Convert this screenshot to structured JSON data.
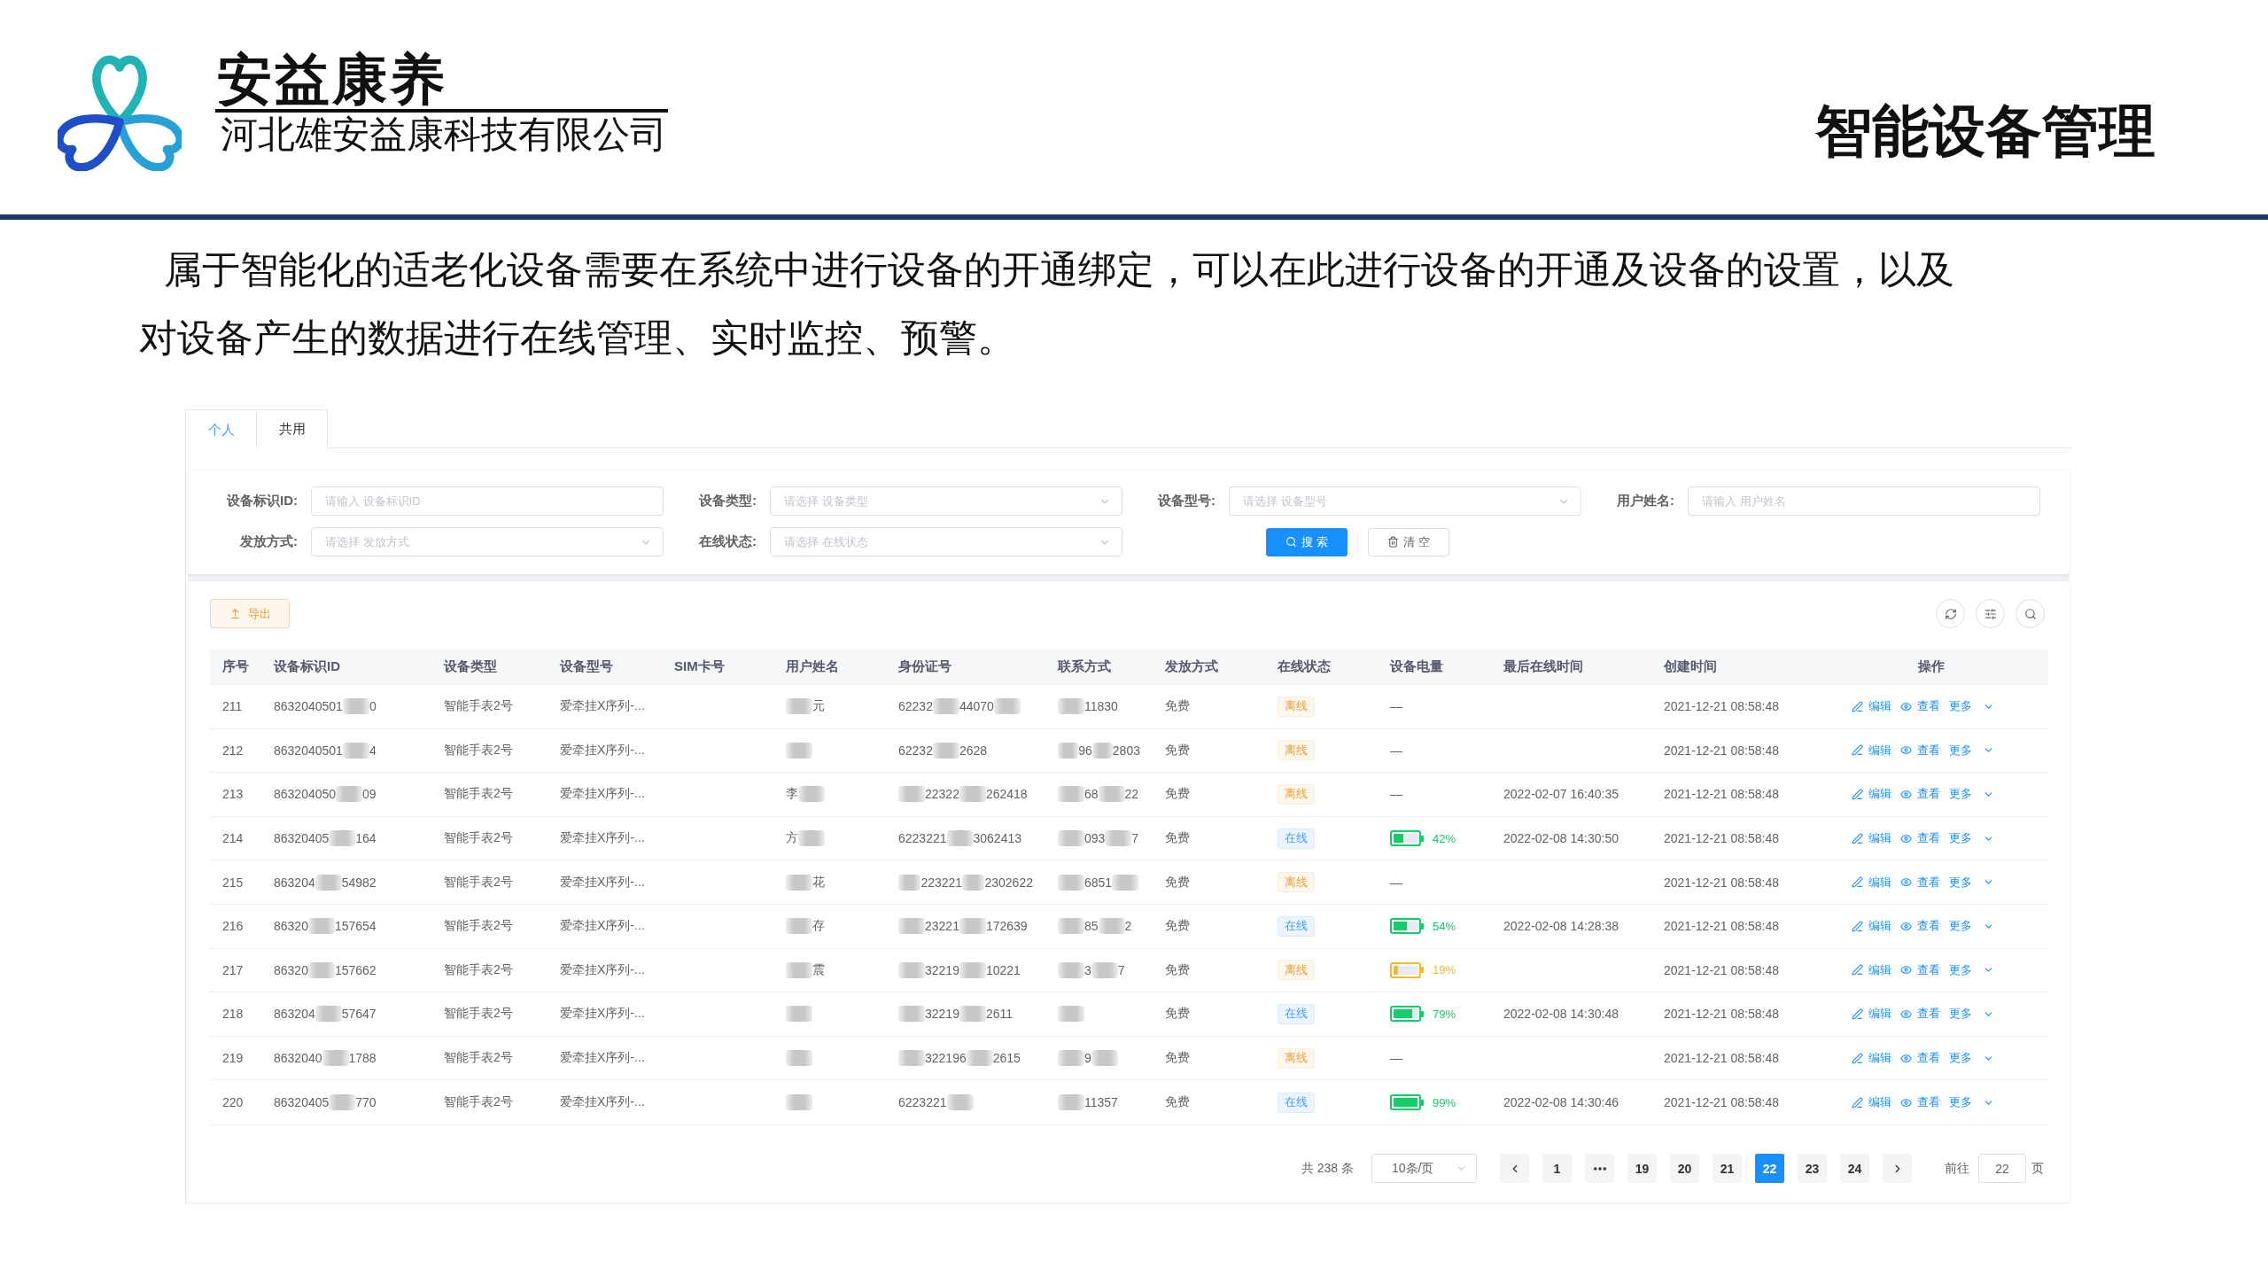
{
  "header": {
    "brand": "安益康养",
    "company": "河北雄安益康科技有限公司",
    "title": "智能设备管理"
  },
  "intro": "属于智能化的适老化设备需要在系统中进行设备的开通绑定，可以在此进行设备的开通及设备的设置，以及对设备产生的数据进行在线管理、实时监控、预警。",
  "screenshot": {
    "tabs": [
      {
        "label": "个人",
        "selected": true
      },
      {
        "label": "共用",
        "selected": false
      }
    ],
    "filters": [
      {
        "kind": "input",
        "label": "设备标识ID:",
        "placeholder": "请输入 设备标识ID"
      },
      {
        "kind": "select",
        "label": "设备类型:",
        "placeholder": "请选择 设备类型"
      },
      {
        "kind": "select",
        "label": "设备型号:",
        "placeholder": "请选择 设备型号"
      },
      {
        "kind": "input",
        "label": "用户姓名:",
        "placeholder": "请输入 用户姓名"
      },
      {
        "kind": "select",
        "label": "发放方式:",
        "placeholder": "请选择 发放方式"
      },
      {
        "kind": "select",
        "label": "在线状态:",
        "placeholder": "请选择 在线状态"
      }
    ],
    "buttons": [
      {
        "kind": "search",
        "label": "搜 索"
      },
      {
        "kind": "clear",
        "label": "清 空"
      }
    ],
    "export_button": "导出",
    "table": {
      "columns": [
        "序号",
        "设备标识ID",
        "设备类型",
        "设备型号",
        "SIM卡号",
        "用户姓名",
        "身份证号",
        "联系方式",
        "发放方式",
        "在线状态",
        "设备电量",
        "最后在线时间",
        "创建时间",
        "操作"
      ],
      "rows": [
        {
          "index": "211",
          "device_id": [
            {
              "kind": "text",
              "text": "8632040501"
            },
            {
              "kind": "blur"
            },
            {
              "kind": "text",
              "text": "0"
            }
          ],
          "device_type": "智能手表2号",
          "model": "爱牵挂X序列-...",
          "name": [
            {
              "kind": "blur"
            },
            {
              "kind": "text",
              "text": "元"
            }
          ],
          "id_card": [
            {
              "kind": "text",
              "text": "62232"
            },
            {
              "kind": "blur"
            },
            {
              "kind": "text",
              "text": "44070"
            },
            {
              "kind": "blur"
            }
          ],
          "phone": [
            {
              "kind": "blur"
            },
            {
              "kind": "text",
              "text": "11830"
            }
          ],
          "method": "免费",
          "status": {
            "text": "离线",
            "online": false
          },
          "battery": {
            "kind": "dash",
            "text": "—"
          },
          "created": "2021-12-21 08:58:48",
          "actions": [
            {
              "kind": "edit",
              "label": "编辑"
            },
            {
              "kind": "view",
              "label": "查看"
            },
            {
              "kind": "more",
              "label": "更多"
            }
          ]
        },
        {
          "index": "212",
          "device_id": [
            {
              "kind": "text",
              "text": "8632040501"
            },
            {
              "kind": "blur"
            },
            {
              "kind": "text",
              "text": "4"
            }
          ],
          "device_type": "智能手表2号",
          "model": "爱牵挂X序列-...",
          "name": [
            {
              "kind": "blur"
            }
          ],
          "id_card": [
            {
              "kind": "text",
              "text": "62232"
            },
            {
              "kind": "blur"
            },
            {
              "kind": "text",
              "text": "2628"
            }
          ],
          "phone": [
            {
              "kind": "blur"
            },
            {
              "kind": "text",
              "text": "96"
            },
            {
              "kind": "blur"
            },
            {
              "kind": "text",
              "text": "2803"
            }
          ],
          "method": "免费",
          "status": {
            "text": "离线",
            "online": false
          },
          "battery": {
            "kind": "dash",
            "text": "—"
          },
          "created": "2021-12-21 08:58:48",
          "actions": [
            {
              "kind": "edit",
              "label": "编辑"
            },
            {
              "kind": "view",
              "label": "查看"
            },
            {
              "kind": "more",
              "label": "更多"
            }
          ]
        },
        {
          "index": "213",
          "device_id": [
            {
              "kind": "text",
              "text": "863204050"
            },
            {
              "kind": "blur"
            },
            {
              "kind": "text",
              "text": "09"
            }
          ],
          "device_type": "智能手表2号",
          "model": "爱牵挂X序列-...",
          "name": [
            {
              "kind": "text",
              "text": "李"
            },
            {
              "kind": "blur"
            }
          ],
          "id_card": [
            {
              "kind": "blur"
            },
            {
              "kind": "text",
              "text": "22322"
            },
            {
              "kind": "blur"
            },
            {
              "kind": "text",
              "text": "262418"
            }
          ],
          "phone": [
            {
              "kind": "blur"
            },
            {
              "kind": "text",
              "text": "68"
            },
            {
              "kind": "blur"
            },
            {
              "kind": "text",
              "text": "22"
            }
          ],
          "method": "免费",
          "status": {
            "text": "离线",
            "online": false
          },
          "battery": {
            "kind": "dash",
            "text": "—"
          },
          "last_online": "2022-02-07 16:40:35",
          "created": "2021-12-21 08:58:48",
          "actions": [
            {
              "kind": "edit",
              "label": "编辑"
            },
            {
              "kind": "view",
              "label": "查看"
            },
            {
              "kind": "more",
              "label": "更多"
            }
          ]
        },
        {
          "index": "214",
          "device_id": [
            {
              "kind": "text",
              "text": "86320405"
            },
            {
              "kind": "blur"
            },
            {
              "kind": "text",
              "text": "164"
            }
          ],
          "device_type": "智能手表2号",
          "model": "爱牵挂X序列-...",
          "name": [
            {
              "kind": "text",
              "text": "方"
            },
            {
              "kind": "blur"
            }
          ],
          "id_card": [
            {
              "kind": "text",
              "text": "6223221"
            },
            {
              "kind": "blur"
            },
            {
              "kind": "text",
              "text": "3062413"
            }
          ],
          "phone": [
            {
              "kind": "blur"
            },
            {
              "kind": "text",
              "text": "093"
            },
            {
              "kind": "blur"
            },
            {
              "kind": "text",
              "text": "7"
            }
          ],
          "method": "免费",
          "status": {
            "text": "在线",
            "online": true
          },
          "battery": {
            "kind": "meter",
            "level": 0.42,
            "reading": "42%",
            "color": "#13ce66"
          },
          "last_online": "2022-02-08 14:30:50",
          "created": "2021-12-21 08:58:48",
          "actions": [
            {
              "kind": "edit",
              "label": "编辑"
            },
            {
              "kind": "view",
              "label": "查看"
            },
            {
              "kind": "more",
              "label": "更多"
            }
          ]
        },
        {
          "index": "215",
          "device_id": [
            {
              "kind": "text",
              "text": "863204"
            },
            {
              "kind": "blur"
            },
            {
              "kind": "text",
              "text": "54982"
            }
          ],
          "device_type": "智能手表2号",
          "model": "爱牵挂X序列-...",
          "name": [
            {
              "kind": "blur"
            },
            {
              "kind": "text",
              "text": "花"
            }
          ],
          "id_card": [
            {
              "kind": "blur"
            },
            {
              "kind": "text",
              "text": "223221"
            },
            {
              "kind": "blur"
            },
            {
              "kind": "text",
              "text": "2302622"
            }
          ],
          "phone": [
            {
              "kind": "blur"
            },
            {
              "kind": "text",
              "text": "6851"
            },
            {
              "kind": "blur"
            }
          ],
          "method": "免费",
          "status": {
            "text": "离线",
            "online": false
          },
          "battery": {
            "kind": "dash",
            "text": "—"
          },
          "created": "2021-12-21 08:58:48",
          "actions": [
            {
              "kind": "edit",
              "label": "编辑"
            },
            {
              "kind": "view",
              "label": "查看"
            },
            {
              "kind": "more",
              "label": "更多"
            }
          ]
        },
        {
          "index": "216",
          "device_id": [
            {
              "kind": "text",
              "text": "86320"
            },
            {
              "kind": "blur"
            },
            {
              "kind": "text",
              "text": "157654"
            }
          ],
          "device_type": "智能手表2号",
          "model": "爱牵挂X序列-...",
          "name": [
            {
              "kind": "blur"
            },
            {
              "kind": "text",
              "text": "存"
            }
          ],
          "id_card": [
            {
              "kind": "blur"
            },
            {
              "kind": "text",
              "text": "23221"
            },
            {
              "kind": "blur"
            },
            {
              "kind": "text",
              "text": "172639"
            }
          ],
          "phone": [
            {
              "kind": "blur"
            },
            {
              "kind": "text",
              "text": "85"
            },
            {
              "kind": "blur"
            },
            {
              "kind": "text",
              "text": "2"
            }
          ],
          "method": "免费",
          "status": {
            "text": "在线",
            "online": true
          },
          "battery": {
            "kind": "meter",
            "level": 0.54,
            "reading": "54%",
            "color": "#13ce66"
          },
          "last_online": "2022-02-08 14:28:38",
          "created": "2021-12-21 08:58:48",
          "actions": [
            {
              "kind": "edit",
              "label": "编辑"
            },
            {
              "kind": "view",
              "label": "查看"
            },
            {
              "kind": "more",
              "label": "更多"
            }
          ]
        },
        {
          "index": "217",
          "device_id": [
            {
              "kind": "text",
              "text": "86320"
            },
            {
              "kind": "blur"
            },
            {
              "kind": "text",
              "text": "157662"
            }
          ],
          "device_type": "智能手表2号",
          "model": "爱牵挂X序列-...",
          "name": [
            {
              "kind": "blur"
            },
            {
              "kind": "text",
              "text": "震"
            }
          ],
          "id_card": [
            {
              "kind": "blur"
            },
            {
              "kind": "text",
              "text": "32219"
            },
            {
              "kind": "blur"
            },
            {
              "kind": "text",
              "text": "10221"
            }
          ],
          "phone": [
            {
              "kind": "blur"
            },
            {
              "kind": "text",
              "text": "3"
            },
            {
              "kind": "blur"
            },
            {
              "kind": "text",
              "text": "7"
            }
          ],
          "method": "免费",
          "status": {
            "text": "离线",
            "online": false
          },
          "battery": {
            "kind": "meter",
            "level": 0.19,
            "reading": "19%",
            "color": "#f7ba2a"
          },
          "created": "2021-12-21 08:58:48",
          "actions": [
            {
              "kind": "edit",
              "label": "编辑"
            },
            {
              "kind": "view",
              "label": "查看"
            },
            {
              "kind": "more",
              "label": "更多"
            }
          ]
        },
        {
          "index": "218",
          "device_id": [
            {
              "kind": "text",
              "text": "863204"
            },
            {
              "kind": "blur"
            },
            {
              "kind": "text",
              "text": "57647"
            }
          ],
          "device_type": "智能手表2号",
          "model": "爱牵挂X序列-...",
          "name": [
            {
              "kind": "blur"
            }
          ],
          "id_card": [
            {
              "kind": "blur"
            },
            {
              "kind": "text",
              "text": "32219"
            },
            {
              "kind": "blur"
            },
            {
              "kind": "text",
              "text": "2611"
            }
          ],
          "phone": [
            {
              "kind": "blur"
            }
          ],
          "method": "免费",
          "status": {
            "text": "在线",
            "online": true
          },
          "battery": {
            "kind": "meter",
            "level": 0.79,
            "reading": "79%",
            "color": "#13ce66"
          },
          "last_online": "2022-02-08 14:30:48",
          "created": "2021-12-21 08:58:48",
          "actions": [
            {
              "kind": "edit",
              "label": "编辑"
            },
            {
              "kind": "view",
              "label": "查看"
            },
            {
              "kind": "more",
              "label": "更多"
            }
          ]
        },
        {
          "index": "219",
          "device_id": [
            {
              "kind": "text",
              "text": "8632040"
            },
            {
              "kind": "blur"
            },
            {
              "kind": "text",
              "text": "1788"
            }
          ],
          "device_type": "智能手表2号",
          "model": "爱牵挂X序列-...",
          "name": [
            {
              "kind": "blur"
            }
          ],
          "id_card": [
            {
              "kind": "blur"
            },
            {
              "kind": "text",
              "text": "322196"
            },
            {
              "kind": "blur"
            },
            {
              "kind": "text",
              "text": "2615"
            }
          ],
          "phone": [
            {
              "kind": "blur"
            },
            {
              "kind": "text",
              "text": "9"
            },
            {
              "kind": "blur"
            }
          ],
          "method": "免费",
          "status": {
            "text": "离线",
            "online": false
          },
          "battery": {
            "kind": "dash",
            "text": "—"
          },
          "created": "2021-12-21 08:58:48",
          "actions": [
            {
              "kind": "edit",
              "label": "编辑"
            },
            {
              "kind": "view",
              "label": "查看"
            },
            {
              "kind": "more",
              "label": "更多"
            }
          ]
        },
        {
          "index": "220",
          "device_id": [
            {
              "kind": "text",
              "text": "86320405"
            },
            {
              "kind": "blur"
            },
            {
              "kind": "text",
              "text": "770"
            }
          ],
          "device_type": "智能手表2号",
          "model": "爱牵挂X序列-...",
          "name": [
            {
              "kind": "blur"
            }
          ],
          "id_card": [
            {
              "kind": "text",
              "text": "6223221"
            },
            {
              "kind": "blur"
            }
          ],
          "phone": [
            {
              "kind": "blur"
            },
            {
              "kind": "text",
              "text": "11357"
            }
          ],
          "method": "免费",
          "status": {
            "text": "在线",
            "online": true
          },
          "battery": {
            "kind": "meter",
            "level": 0.99,
            "reading": "99%",
            "color": "#13ce66"
          },
          "last_online": "2022-02-08 14:30:46",
          "created": "2021-12-21 08:58:48",
          "actions": [
            {
              "kind": "edit",
              "label": "编辑"
            },
            {
              "kind": "view",
              "label": "查看"
            },
            {
              "kind": "more",
              "label": "更多"
            }
          ]
        }
      ]
    },
    "pagination": {
      "total": "共 238 条",
      "page_size": "10条/页",
      "pages": [
        {
          "kind": "page",
          "label": "1",
          "selected": false
        },
        {
          "kind": "ellipsis",
          "selected": false
        },
        {
          "kind": "page",
          "label": "19",
          "selected": false
        },
        {
          "kind": "page",
          "label": "20",
          "selected": false
        },
        {
          "kind": "page",
          "label": "21",
          "selected": false
        },
        {
          "kind": "page",
          "label": "22",
          "selected": true
        },
        {
          "kind": "page",
          "label": "23",
          "selected": false
        },
        {
          "kind": "page",
          "label": "24",
          "selected": false
        }
      ],
      "goto_label": "前往",
      "goto_value": "22",
      "goto_suffix": "页"
    }
  }
}
